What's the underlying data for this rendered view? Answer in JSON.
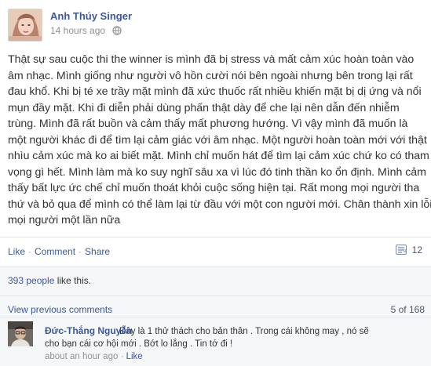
{
  "post": {
    "author": "Anh Thúy Singer",
    "timestamp": "14 hours ago",
    "privacy_icon": "globe-icon",
    "text_lines": [
      "Thật sự sau cuộc thi the winner is mình đã bị stress và mất cảm xúc hoàn toàn vào",
      "âm nhạc. Mình giống như người vô hồn cười nói bên ngoài nhưng bên trong lại rất",
      "đau khổ. Khi bị té xe trầy mặt mình đã xức thuốc rất nhiều khiến mặt bị dị ứng và nổi",
      "mụn đầy mặt. Khi đi diễn phải dùng phấn thật dày để che lại nên dẫn đến nhiễm",
      "trùng. Mình đã rất buồn và cảm thấy mất phương hướng. Vì vậy mình đã muốn là",
      "một người khác đi để tìm lại cảm giác với âm nhạc. Một người hoàn toàn mới với thật",
      "nhìu cảm xúc mà ko ai biết mặt. Mình chỉ muốn hát để tìm lại cảm xúc chứ ko có tham",
      "vọng gì hết. Mình làm mà ko suy nghĩ sâu xa vì lúc đó tinh thần ko ổn định. Mình cảm",
      "thấy bất lực ức chế chỉ muốn thoát khỏi cuộc sống hiện tại. Rất mong mọi người tha",
      "thứ và bỏ qua để mình có thể làm lại từ đầu với một con người mới. Chân thành xin lỗi",
      "mọi người một lần nữa"
    ]
  },
  "actions": {
    "like": "Like",
    "comment": "Comment",
    "share": "Share",
    "separator": "·",
    "share_count": "12",
    "share_icon": "share-icon"
  },
  "ufi": {
    "likes_count": "393 people",
    "likes_suffix": " like this.",
    "view_previous": "View previous comments",
    "pager": "5 of 168"
  },
  "comment": {
    "author": "Đức-Thắng Nguyễn",
    "text_first": "Đây là 1 thử thách cho bản thân . Trong cái không may , nó sẽ",
    "text_second": "cho bạn cái cơ hội mới . Bớt lo lắng . Tin tớ đi !",
    "time": "about an hour ago",
    "separator": "·",
    "like": "Like"
  }
}
